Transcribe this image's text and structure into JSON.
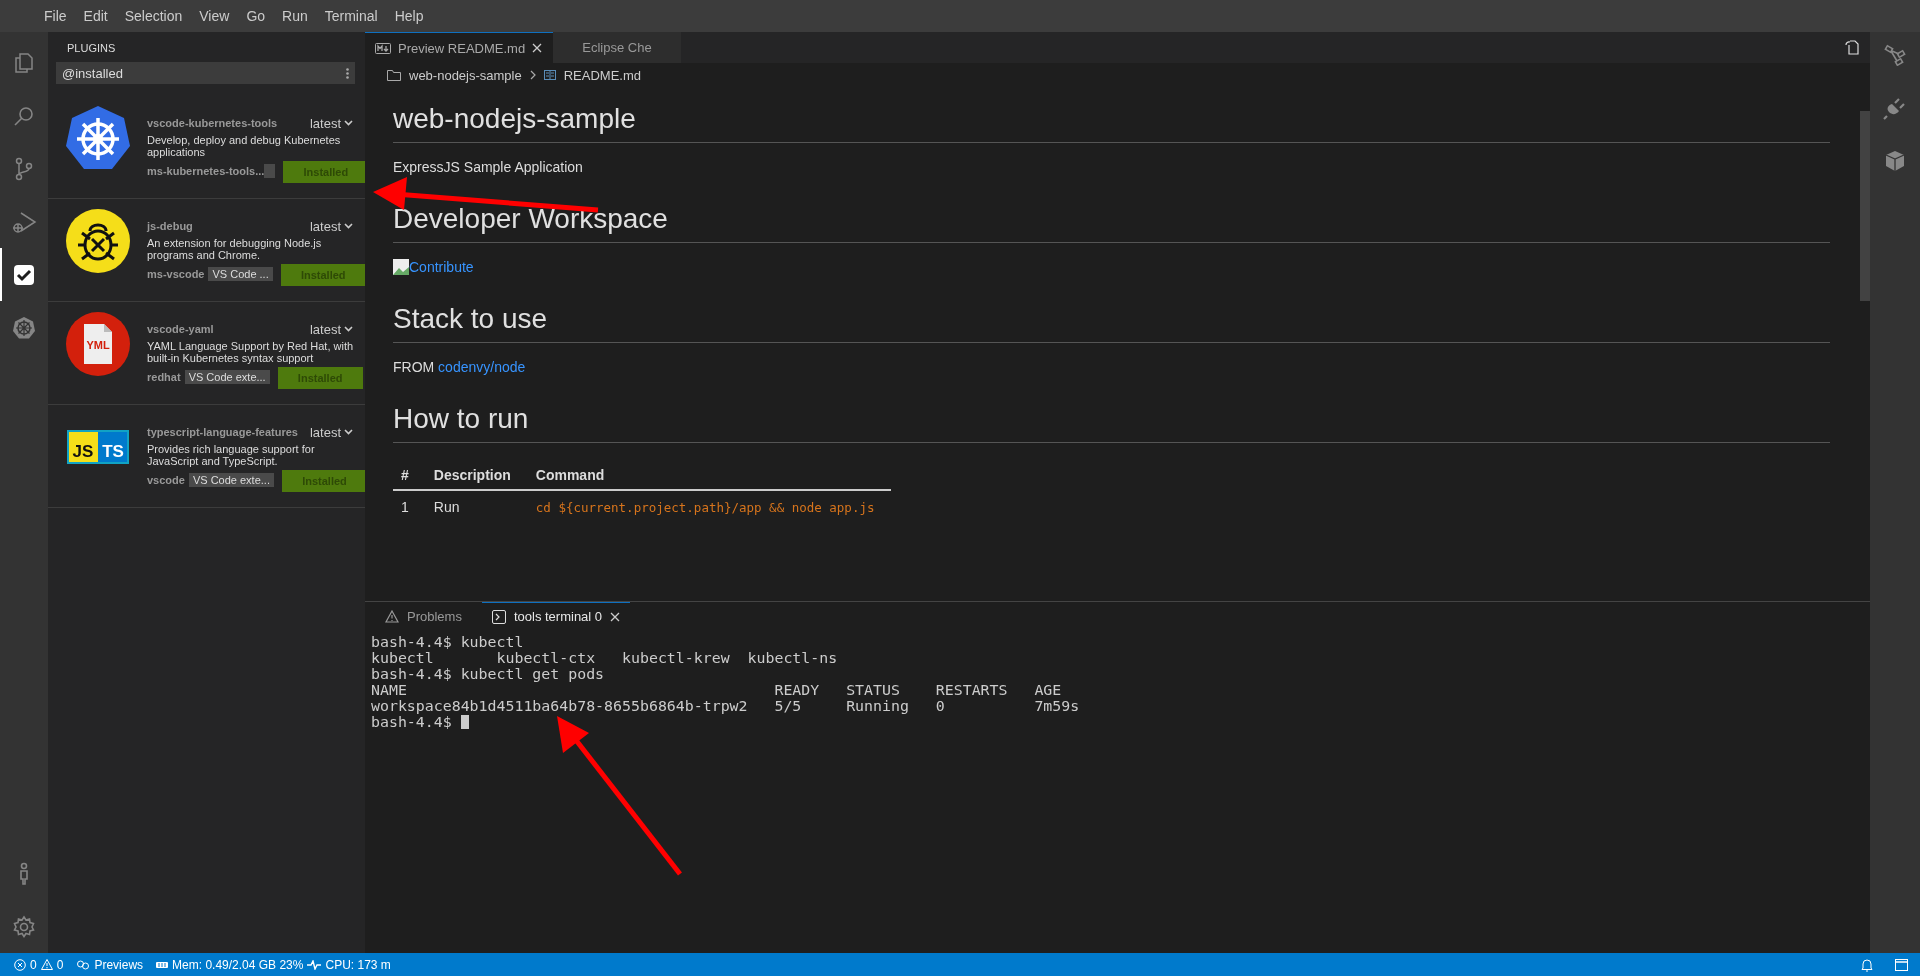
{
  "menu": [
    "File",
    "Edit",
    "Selection",
    "View",
    "Go",
    "Run",
    "Terminal",
    "Help"
  ],
  "activity_bar": {
    "top": [
      {
        "kind": "files",
        "selected": false
      },
      {
        "kind": "search",
        "selected": false
      },
      {
        "kind": "branch",
        "selected": false
      },
      {
        "kind": "debug",
        "selected": false
      },
      {
        "kind": "plugins",
        "selected": true
      },
      {
        "kind": "wheel",
        "selected": false
      }
    ],
    "bottom": [
      {
        "kind": "person",
        "selected": false
      },
      {
        "kind": "gear",
        "selected": false
      }
    ]
  },
  "sidebar": {
    "title": "PLUGINS",
    "search": {
      "value": "@installed"
    },
    "plugins": [
      {
        "kind": "kubernetes",
        "name": "vscode-kubernetes-tools",
        "version": "latest",
        "description": "Develop, deploy and debug Kubernetes applications",
        "publisher": "ms-kubernetes-tools...",
        "tag_blank": true,
        "button": "Installed"
      },
      {
        "kind": "bug",
        "name": "js-debug",
        "version": "latest",
        "description": "An extension for debugging Node.js programs and Chrome.",
        "publisher": "ms-vscode",
        "tag": "VS Code ...",
        "button": "Installed"
      },
      {
        "kind": "yaml",
        "name": "vscode-yaml",
        "version": "latest",
        "description": "YAML Language Support by Red Hat, with built-in Kubernetes syntax support",
        "publisher": "redhat",
        "tag": "VS Code exte...",
        "button": "Installed",
        "icon_text": "YML"
      },
      {
        "kind": "jsts",
        "name": "typescript-language-features",
        "version": "latest",
        "description": "Provides rich language support for JavaScript and TypeScript.",
        "publisher": "vscode",
        "tag": "VS Code exte...",
        "button": "Installed",
        "icon_text": "JS",
        "icon_text2": "TS"
      }
    ]
  },
  "editor": {
    "tabs": [
      {
        "label": "Preview README.md",
        "selected": true,
        "closable": true
      },
      {
        "label": "Eclipse Che",
        "selected": false,
        "closable": false
      }
    ],
    "breadcrumbs": [
      "web-nodejs-sample",
      "README.md"
    ],
    "document": [
      {
        "kind": "h1",
        "text": "web-nodejs-sample"
      },
      {
        "kind": "p",
        "text": "ExpressJS Sample Application"
      },
      {
        "kind": "h1",
        "text": "Developer Workspace"
      },
      {
        "kind": "image_link",
        "text": "Contribute"
      },
      {
        "kind": "h1",
        "text": "Stack to use"
      },
      {
        "kind": "p_link",
        "text": "FROM",
        "link": "codenvy/node"
      },
      {
        "kind": "h1",
        "text": "How to run"
      },
      {
        "kind": "table",
        "columns": [
          "#",
          "Description",
          "Command"
        ],
        "rows": [
          [
            "1",
            "Run",
            "cd ${current.project.path}/app && node app.js"
          ]
        ]
      }
    ]
  },
  "panel": {
    "tabs": [
      {
        "label": "Problems",
        "kind": "problems",
        "selected": false
      },
      {
        "label": "tools terminal 0",
        "kind": "terminal",
        "selected": true
      }
    ],
    "terminal_lines": [
      "bash-4.4$ kubectl",
      "kubectl       kubectl-ctx   kubectl-krew  kubectl-ns",
      "bash-4.4$ kubectl get pods",
      "NAME                                         READY   STATUS    RESTARTS   AGE",
      "workspace84b1d4511ba64b78-8655b6864b-trpw2   5/5     Running   0          7m59s",
      "bash-4.4$ "
    ]
  },
  "status_bar": {
    "errors": "0",
    "warnings": "0",
    "previews": "Previews",
    "memory": "Mem: 0.49/2.04 GB 23%",
    "cpu": "CPU: 173 m"
  }
}
